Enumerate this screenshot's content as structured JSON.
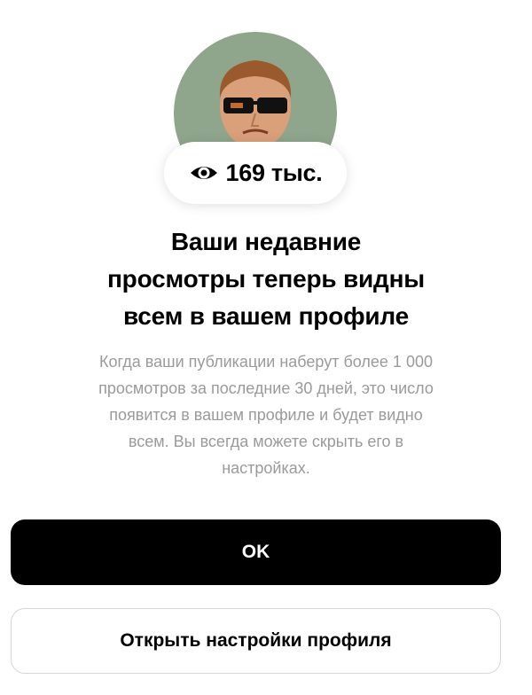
{
  "profile": {
    "avatar_icon": "profile-avatar-illustration",
    "views_icon": "eye-icon",
    "views_count": "169 тыс."
  },
  "dialog": {
    "headline_lines": [
      "Ваши недавние",
      "просмотры теперь видны",
      "всем в вашем профиле"
    ],
    "description_lines": [
      "Когда ваши публикации наберут более 1 000",
      "просмотров за последние 30 дней, это число",
      "появится в вашем профиле и будет видно",
      "всем. Вы всегда можете скрыть его в",
      "настройках."
    ],
    "ok_label": "OK",
    "settings_label": "Открыть настройки профиля"
  },
  "colors": {
    "primary_button_bg": "#000000",
    "secondary_text": "#9a9a9a",
    "avatar_bg": "#8fa58c"
  }
}
